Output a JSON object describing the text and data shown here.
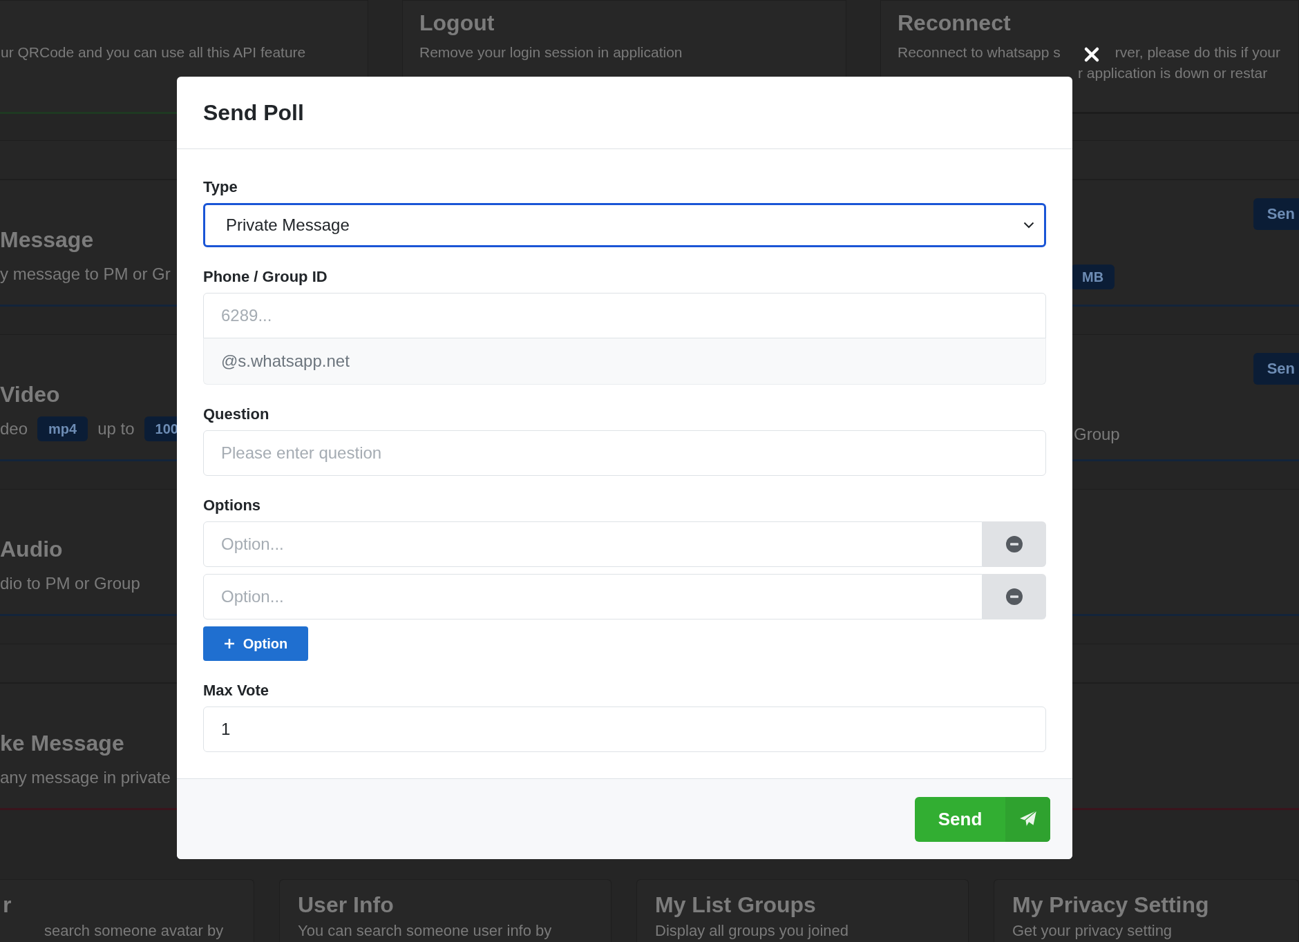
{
  "background": {
    "top_cards": [
      {
        "color": "#1e3a22",
        "lines": [
          [
            "ur QRCode and you can use all this API feature"
          ]
        ]
      },
      {
        "title": "Logout",
        "color": "#1c1c1c",
        "lines": [
          [
            "Remove your login session in application"
          ]
        ]
      },
      {
        "title": "Reconnect",
        "color": "#1c1c1c",
        "lines": [
          [
            "Reconnect to whatsapp s",
            "rver, please do this if your"
          ],
          [
            "r application is down or restar"
          ]
        ]
      }
    ],
    "feature_cards": [
      {
        "kind": "strip"
      },
      {
        "kind": "card",
        "title": "Message",
        "color": "#13243a",
        "parts": [
          {
            "kind": "text",
            "text": "y message to PM or Gr"
          }
        ],
        "action": "Sen",
        "side": {
          "kind": "badge",
          "text": "MB"
        }
      },
      {
        "kind": "card",
        "title": "Video",
        "color": "#13243a",
        "parts": [
          {
            "kind": "text",
            "text": "deo"
          },
          {
            "kind": "badge",
            "text": "mp4"
          },
          {
            "kind": "text",
            "text": "up to"
          },
          {
            "kind": "badge",
            "text": "100"
          }
        ],
        "action": "Sen",
        "side": {
          "kind": "text",
          "text": "Group"
        }
      },
      {
        "kind": "card",
        "title": "Audio",
        "color": "#13243a",
        "parts": [
          {
            "kind": "text",
            "text": "dio to PM or Group"
          }
        ]
      },
      {
        "kind": "strip"
      },
      {
        "kind": "card",
        "title": "ke Message",
        "color": "#3a141c",
        "parts": [
          {
            "kind": "text",
            "text": "any message in private"
          }
        ]
      }
    ],
    "bottom_cards": [
      {
        "title": "r",
        "description": "search someone avatar by"
      },
      {
        "title": "User Info",
        "description": "You can search someone user info by"
      },
      {
        "title": "My List Groups",
        "description": "Display all groups you joined"
      },
      {
        "title": "My Privacy Setting",
        "description": "Get your privacy setting"
      }
    ]
  },
  "modal": {
    "title": "Send Poll",
    "fields": [
      {
        "kind": "select",
        "label": "Type",
        "value": "Private Message",
        "focused": true
      },
      {
        "kind": "input",
        "label": "Phone / Group ID",
        "placeholder": "6289...",
        "addon": "@s.whatsapp.net"
      },
      {
        "kind": "input",
        "label": "Question",
        "placeholder": "Please enter question"
      },
      {
        "kind": "options",
        "label": "Options",
        "options": [
          {
            "placeholder": "Option..."
          },
          {
            "placeholder": "Option..."
          }
        ],
        "add_button": "Option"
      },
      {
        "kind": "input",
        "label": "Max Vote",
        "value": "1"
      }
    ],
    "submit": "Send"
  }
}
